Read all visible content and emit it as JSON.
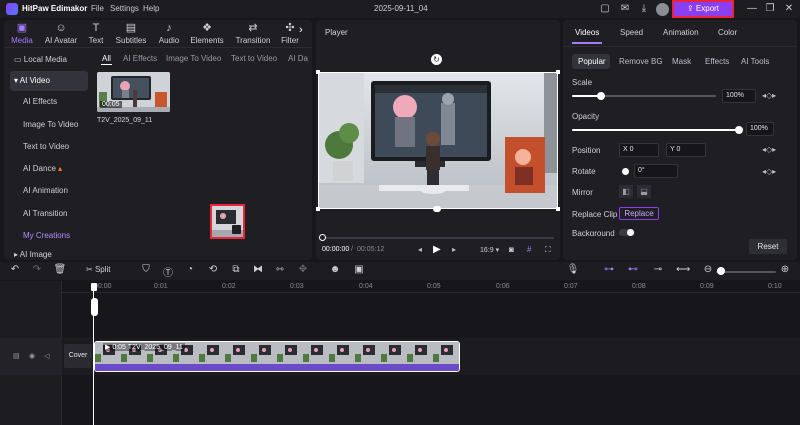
{
  "app": {
    "title": "HitPaw Edimakor",
    "menus": [
      "File",
      "Settings",
      "Help"
    ],
    "project_name": "2025-09-11_04",
    "export_label": "Export"
  },
  "toolbar_tabs": [
    {
      "label": "Media",
      "icon": "media-icon"
    },
    {
      "label": "AI Avatar",
      "icon": "ai-avatar-icon"
    },
    {
      "label": "Text",
      "icon": "text-icon"
    },
    {
      "label": "Subtitles",
      "icon": "subtitles-icon"
    },
    {
      "label": "Audio",
      "icon": "audio-icon"
    },
    {
      "label": "Elements",
      "icon": "elements-icon"
    },
    {
      "label": "Transition",
      "icon": "transition-icon"
    },
    {
      "label": "Filter",
      "icon": "filter-icon"
    }
  ],
  "sidebar": {
    "items": [
      "Local Media",
      "AI Video",
      "AI Effects",
      "Image To Video",
      "Text to Video",
      "AI Dance",
      "AI Animation",
      "AI Transition",
      "My Creations",
      "AI Image"
    ]
  },
  "media_subtabs": [
    "All",
    "AI Effects",
    "Image To Video",
    "Text to Video",
    "AI Da"
  ],
  "media_item": {
    "duration": "00:05",
    "name": "T2V_2025_09_11"
  },
  "player": {
    "title": "Player",
    "current_time": "00:00:00",
    "total_time": "00:05:12",
    "aspect": "16:9"
  },
  "right_panel": {
    "tabs": [
      "Videos",
      "Speed",
      "Animation",
      "Color"
    ],
    "subtabs": [
      "Popular",
      "Remove BG",
      "Mask",
      "Effects",
      "AI Tools"
    ],
    "scale_label": "Scale",
    "scale_value": "100%",
    "opacity_label": "Opacity",
    "opacity_value": "100%",
    "position_label": "Position",
    "pos_x_label": "X",
    "pos_x": "0",
    "pos_y_label": "Y",
    "pos_y": "0",
    "rotate_label": "Rotate",
    "rotate_value": "0°",
    "mirror_label": "Mirror",
    "replace_clip_label": "Replace Clip",
    "replace_button": "Replace",
    "background_label": "Background",
    "reset_label": "Reset"
  },
  "timeline": {
    "split_label": "Split",
    "ruler": [
      "00:00",
      "0:01",
      "0:02",
      "0:03",
      "0:04",
      "0:05",
      "0:06",
      "0:07",
      "0:08",
      "0:09",
      "0:10"
    ],
    "cover_label": "Cover",
    "clip_label": "0:05 T2V_2025_09_11"
  },
  "colors": {
    "accent": "#8b3df0",
    "accent_text": "#a57aff",
    "export_highlight": "#e8253a",
    "clip": "#6a4bc8"
  }
}
